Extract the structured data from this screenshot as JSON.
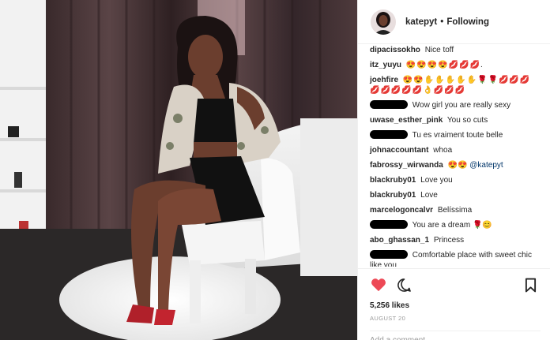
{
  "post": {
    "username": "katepyt",
    "separator": "•",
    "follow_status": "Following",
    "likes": "5,256 likes",
    "date": "AUGUST 20",
    "add_comment_placeholder": "Add a comment..."
  },
  "comments": [
    {
      "user": "dipacissokho",
      "text": "Nice toff"
    },
    {
      "user": "itz_yuyu",
      "text": "😍😍😍😍💋💋💋."
    },
    {
      "user": "joehfire",
      "text": "😍😍✋✋✋✋✋🌹🌹💋💋💋💋💋💋💋💋👌💋💋💋"
    },
    {
      "user": "",
      "redacted": true,
      "text": "Wow girl you are really sexy"
    },
    {
      "user": "uwase_esther_pink",
      "text": "You so cuts"
    },
    {
      "user": "",
      "redacted": true,
      "text": "Tu es vraiment toute belle"
    },
    {
      "user": "johnaccountant",
      "text": "whoa"
    },
    {
      "user": "fabrossy_wirwanda",
      "text": "😍😍",
      "mention": "@katepyt"
    },
    {
      "user": "blackruby01",
      "text": "Love you"
    },
    {
      "user": "blackruby01",
      "text": "Love"
    },
    {
      "user": "marcelogoncalvr",
      "text": "Belíssima"
    },
    {
      "user": "",
      "redacted": true,
      "text": "You are a dream 🌹😊"
    },
    {
      "user": "abo_ghassan_1",
      "text": "Princess"
    },
    {
      "user": "",
      "redacted": true,
      "text": "Comfortable place with sweet chic like you"
    }
  ],
  "icons": {
    "like": "heart-icon",
    "comment": "speech-bubble-icon",
    "save": "bookmark-icon"
  },
  "colors": {
    "heart": "#ed4956",
    "mention": "#003569",
    "muted": "#999999",
    "border": "#efefef"
  }
}
